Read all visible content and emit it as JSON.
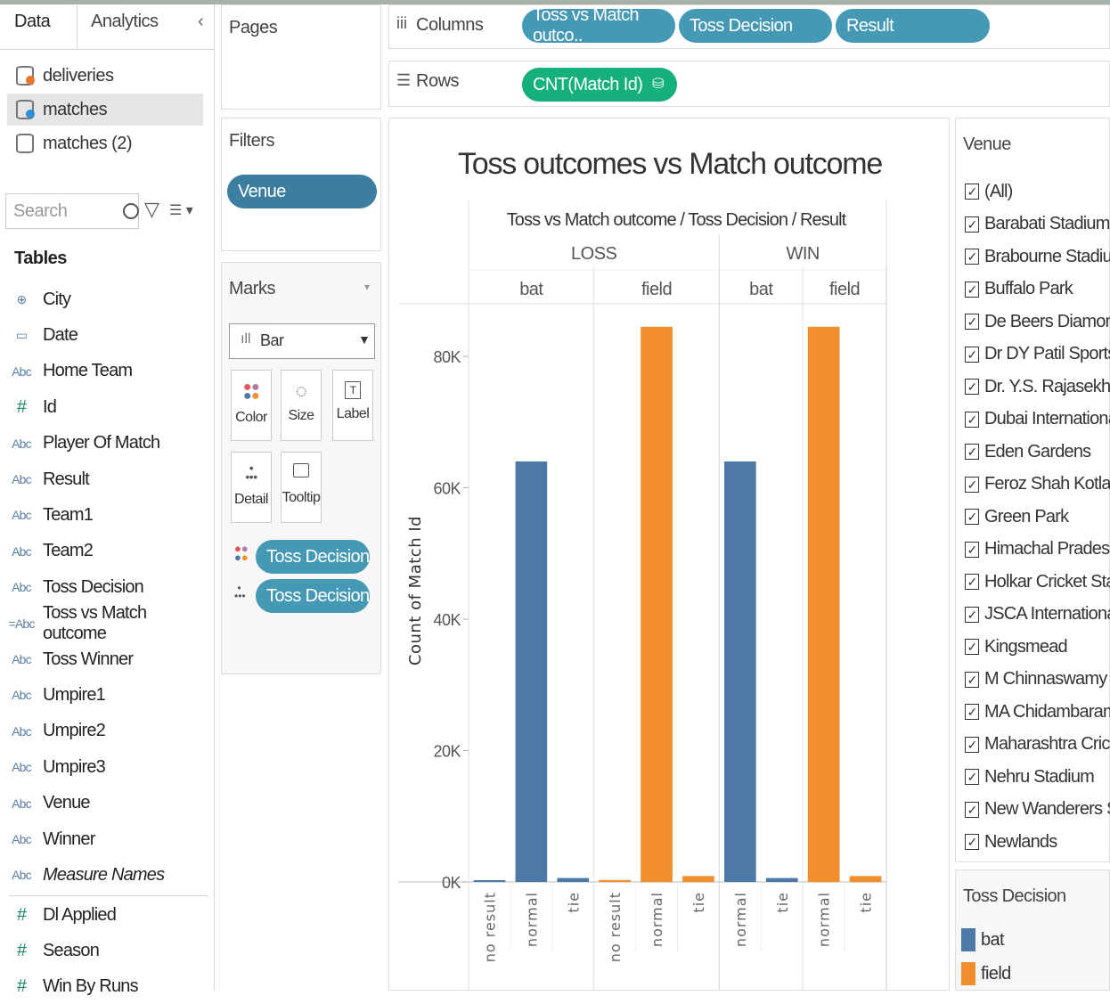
{
  "left_pane": {
    "tabs": [
      "Data",
      "Analytics"
    ],
    "datasources": [
      {
        "name": "deliveries",
        "status_color": "#e8762c"
      },
      {
        "name": "matches",
        "status_color": "#2f8fd0"
      },
      {
        "name": "matches (2)",
        "status_color": ""
      }
    ],
    "search_placeholder": "Search",
    "tables_heading": "Tables",
    "fields": [
      {
        "type": "globe",
        "type_label": "⊕",
        "name": "City"
      },
      {
        "type": "date",
        "type_label": "▭",
        "name": "Date"
      },
      {
        "type": "string",
        "type_label": "Abc",
        "name": "Home Team"
      },
      {
        "type": "number",
        "type_label": "#",
        "name": "Id"
      },
      {
        "type": "string",
        "type_label": "Abc",
        "name": "Player Of Match"
      },
      {
        "type": "string",
        "type_label": "Abc",
        "name": "Result"
      },
      {
        "type": "string",
        "type_label": "Abc",
        "name": "Team1"
      },
      {
        "type": "string",
        "type_label": "Abc",
        "name": "Team2"
      },
      {
        "type": "string",
        "type_label": "Abc",
        "name": "Toss Decision"
      },
      {
        "type": "calc-string",
        "type_label": "=Abc",
        "name": "Toss vs Match outcome"
      },
      {
        "type": "string",
        "type_label": "Abc",
        "name": "Toss Winner"
      },
      {
        "type": "string",
        "type_label": "Abc",
        "name": "Umpire1"
      },
      {
        "type": "string",
        "type_label": "Abc",
        "name": "Umpire2"
      },
      {
        "type": "string",
        "type_label": "Abc",
        "name": "Umpire3"
      },
      {
        "type": "string",
        "type_label": "Abc",
        "name": "Venue"
      },
      {
        "type": "string",
        "type_label": "Abc",
        "name": "Winner"
      },
      {
        "type": "string",
        "type_label": "Abc",
        "name": "Measure Names"
      }
    ],
    "measures": [
      {
        "type_label": "#",
        "name": "Dl Applied"
      },
      {
        "type_label": "#",
        "name": "Season"
      },
      {
        "type_label": "#",
        "name": "Win By Runs"
      }
    ]
  },
  "shelves": {
    "pages_title": "Pages",
    "filters_title": "Filters",
    "filter_pill": "Venue",
    "columns_label": "Columns",
    "rows_label": "Rows",
    "columns_pills": [
      "Toss vs Match outco..",
      "Toss Decision",
      "Result"
    ],
    "rows_pill": "CNT(Match Id)"
  },
  "marks": {
    "title": "Marks",
    "mark_type": "Bar",
    "buttons": [
      "Color",
      "Size",
      "Label",
      "Detail",
      "Tooltip"
    ],
    "color_pill": "Toss Decision",
    "detail_pill": "Toss Decision"
  },
  "chart_data": {
    "type": "bar",
    "title": "Toss outcomes vs Match outcome",
    "header_path": "Toss vs Match outcome / Toss Decision / Result",
    "ylabel": "Count of Match Id",
    "ylim": [
      0,
      88000
    ],
    "yticks": [
      0,
      20000,
      40000,
      60000,
      80000
    ],
    "ytick_labels": [
      "0K",
      "20K",
      "40K",
      "60K",
      "80K"
    ],
    "outcome_groups": [
      {
        "label": "LOSS",
        "decisions": [
          {
            "label": "bat",
            "color": "#4e79a7",
            "bars": [
              {
                "result": "no result",
                "value": 0
              },
              {
                "result": "normal",
                "value": 64000
              },
              {
                "result": "tie",
                "value": 600
              }
            ]
          },
          {
            "label": "field",
            "color": "#f28e2b",
            "bars": [
              {
                "result": "no result",
                "value": 300
              },
              {
                "result": "normal",
                "value": 84500
              },
              {
                "result": "tie",
                "value": 900
              }
            ]
          }
        ]
      },
      {
        "label": "WIN",
        "decisions": [
          {
            "label": "bat",
            "color": "#4e79a7",
            "bars": [
              {
                "result": "normal",
                "value": 64000
              },
              {
                "result": "tie",
                "value": 600
              }
            ]
          },
          {
            "label": "field",
            "color": "#f28e2b",
            "bars": [
              {
                "result": "normal",
                "value": 84500
              },
              {
                "result": "tie",
                "value": 900
              }
            ]
          }
        ]
      }
    ]
  },
  "venue_filter": {
    "title": "Venue",
    "items": [
      "(All)",
      "Barabati Stadium",
      "Brabourne Stadium",
      "Buffalo Park",
      "De Beers Diamond ...",
      "Dr DY Patil Sports ...",
      "Dr. Y.S. Rajasekhar...",
      "Dubai International...",
      "Eden Gardens",
      "Feroz Shah Kotla",
      "Green Park",
      "Himachal Pradesh C...",
      "Holkar Cricket Stad...",
      "JSCA International ...",
      "Kingsmead",
      "M Chinnaswamy St...",
      "MA Chidambaram S...",
      "Maharashtra Cricke...",
      "Nehru Stadium",
      "New Wanderers St...",
      "Newlands"
    ]
  },
  "toss_decision_legend": {
    "title": "Toss Decision",
    "items": [
      {
        "label": "bat",
        "color": "#4e79a7"
      },
      {
        "label": "field",
        "color": "#f28e2b"
      }
    ]
  }
}
